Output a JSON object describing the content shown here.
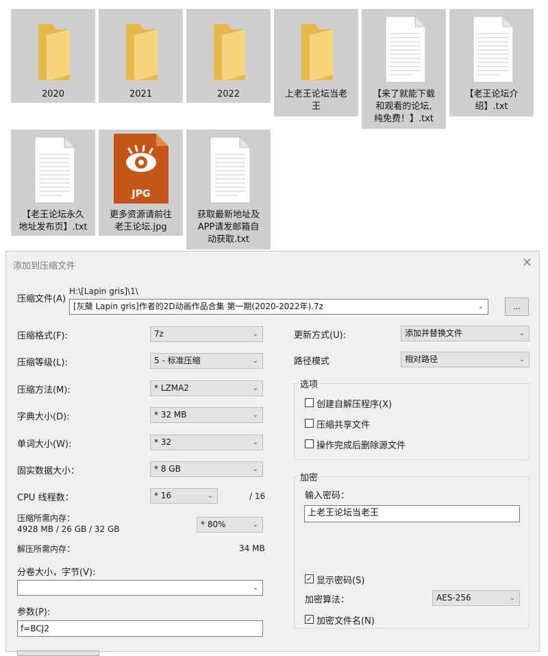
{
  "files": [
    {
      "name": "2020",
      "type": "folder"
    },
    {
      "name": "2021",
      "type": "folder"
    },
    {
      "name": "2022",
      "type": "folder"
    },
    {
      "name_lines": [
        "上老王论坛当老",
        "王"
      ],
      "type": "folder"
    },
    {
      "name_lines": [
        "【来了就能下载",
        "和观看的论坛,",
        "纯免费！】.txt"
      ],
      "type": "text"
    },
    {
      "name_lines": [
        "【老王论坛介",
        "绍】.txt"
      ],
      "type": "text"
    },
    {
      "name_lines": [
        "【老王论坛永久",
        "地址发布页】.txt"
      ],
      "type": "text"
    },
    {
      "name_lines": [
        "更多资源请前往",
        "老王论坛.jpg"
      ],
      "type": "jpg",
      "badge": "JPG"
    },
    {
      "name_lines": [
        "获取最新地址及",
        "APP请发邮箱自",
        "动获取.txt"
      ],
      "type": "text"
    }
  ],
  "dialog": {
    "title": "添加到压缩文件",
    "archive": {
      "label": "压缩文件(A)",
      "path": "H:\\[Lapin gris]\\1\\",
      "value": "[灰蘖 Lapin gris]作者的2D动画作品合集 第一期(2020-2022年).7z",
      "browse": "..."
    },
    "format": {
      "label": "压缩格式(F):",
      "value": "7z"
    },
    "level": {
      "label": "压缩等级(L):",
      "value": "5 - 标准压缩"
    },
    "method": {
      "label": "压缩方法(M):",
      "value": "* LZMA2"
    },
    "dict": {
      "label": "字典大小(D):",
      "value": "* 32 MB"
    },
    "word": {
      "label": "单词大小(W):",
      "value": "* 32"
    },
    "solid": {
      "label": "固实数据大小：",
      "value": "* 8 GB"
    },
    "threads": {
      "label": "CPU 线程数：",
      "value": "* 16",
      "max": "/ 16"
    },
    "mem_compress": {
      "label": "压缩所需内存：",
      "detail": "4928 MB / 26 GB / 32 GB",
      "value": "* 80%"
    },
    "mem_decompress": {
      "label": "解压所需内存：",
      "value": "34 MB"
    },
    "split": {
      "label": "分卷大小，字节(V):",
      "value": ""
    },
    "params": {
      "label": "参数(P):",
      "value": "f=BCJ2"
    },
    "update": {
      "label": "更新方式(U):",
      "value": "添加并替换文件"
    },
    "pathmode": {
      "label": "路径模式",
      "value": "相对路径"
    },
    "options": {
      "title": "选项",
      "items": [
        {
          "label": "创建自解压程序(X)",
          "checked": false
        },
        {
          "label": "压缩共享文件",
          "checked": false
        },
        {
          "label": "操作完成后删除源文件",
          "checked": false
        }
      ]
    },
    "encryption": {
      "title": "加密",
      "password_label": "输入密码：",
      "password": "上老王论坛当老王",
      "show_password": {
        "label": "显示密码(S)",
        "checked": true
      },
      "method_label": "加密算法：",
      "method": "AES-256",
      "encrypt_names": {
        "label": "加密文件名(N)",
        "checked": true
      }
    }
  },
  "colors": {
    "tile_selected": "#cfcfcf",
    "folder": "#f2cf6b",
    "jpg": "#c9601b",
    "dialog_bg": "#f0f0f0"
  }
}
